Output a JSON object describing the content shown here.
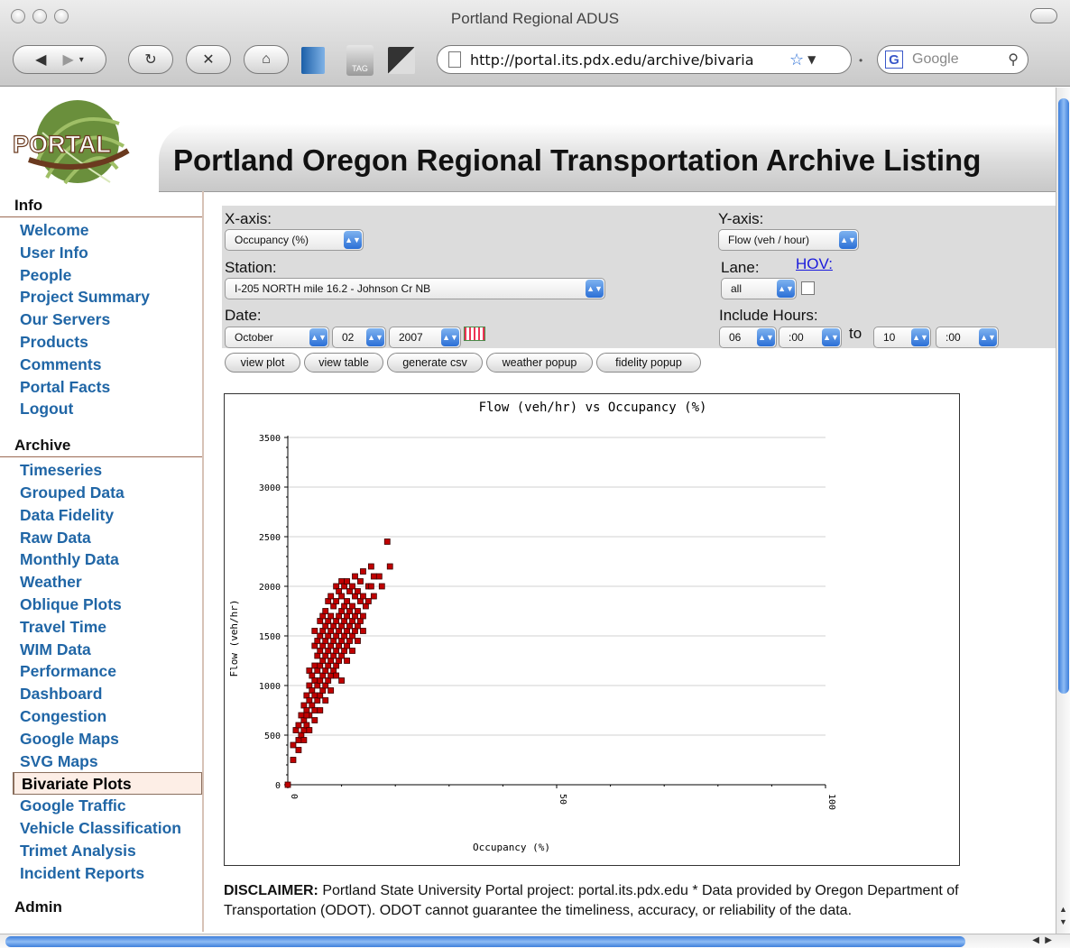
{
  "window": {
    "title": "Portland Regional ADUS"
  },
  "browser": {
    "url": "http://portal.its.pdx.edu/archive/bivaria",
    "search_placeholder": "Google",
    "tag_label": "TAG"
  },
  "header": {
    "logo_text": "PORTAL",
    "title": "Portland Oregon Regional Transportation Archive Listing"
  },
  "sidebar": {
    "info_heading": "Info",
    "info_items": [
      "Welcome",
      "User Info",
      "People",
      "Project Summary",
      "Our Servers",
      "Products",
      "Comments",
      "Portal Facts",
      "Logout"
    ],
    "archive_heading": "Archive",
    "archive_items": [
      "Timeseries",
      "Grouped Data",
      "Data Fidelity",
      "Raw Data",
      "Monthly Data",
      "Weather",
      "Oblique Plots",
      "Travel Time",
      "WIM Data",
      "Performance",
      "Dashboard",
      "Congestion",
      "Google Maps",
      "SVG Maps",
      "Bivariate Plots",
      "Google Traffic",
      "Vehicle Classification",
      "Trimet Analysis",
      "Incident Reports"
    ],
    "active_item": "Bivariate Plots",
    "admin_heading": "Admin"
  },
  "controls": {
    "xaxis_label": "X-axis:",
    "xaxis_value": "Occupancy (%)",
    "yaxis_label": "Y-axis:",
    "yaxis_value": "Flow (veh / hour)",
    "station_label": "Station:",
    "station_value": "I-205 NORTH mile 16.2 - Johnson Cr NB",
    "lane_label": "Lane:",
    "lane_value": "all",
    "hov_label": "HOV:",
    "date_label": "Date:",
    "month": "October",
    "day": "02",
    "year": "2007",
    "hours_label": "Include Hours:",
    "hour_from": "06",
    "min_from": ":00",
    "to_label": "to",
    "hour_to": "10",
    "min_to": ":00",
    "buttons": [
      "view plot",
      "view table",
      "generate csv",
      "weather popup",
      "fidelity popup"
    ]
  },
  "chart_data": {
    "type": "scatter",
    "title": "Flow (veh/hr) vs Occupancy (%)",
    "xlabel": "Occupancy (%)",
    "ylabel": "Flow (veh/hr)",
    "xlim": [
      0,
      100
    ],
    "ylim": [
      0,
      3500
    ],
    "x_ticks": [
      0,
      50,
      100
    ],
    "y_ticks": [
      0,
      500,
      1000,
      1500,
      2000,
      2500,
      3000,
      3500
    ],
    "grid": "horizontal",
    "marker_color": "#c00000",
    "points": [
      [
        0,
        0
      ],
      [
        1,
        250
      ],
      [
        1,
        400
      ],
      [
        1.5,
        550
      ],
      [
        2,
        350
      ],
      [
        2,
        450
      ],
      [
        2,
        600
      ],
      [
        2.5,
        500
      ],
      [
        2.5,
        700
      ],
      [
        3,
        550
      ],
      [
        3,
        650
      ],
      [
        3,
        800
      ],
      [
        3.5,
        600
      ],
      [
        3.5,
        750
      ],
      [
        3.5,
        900
      ],
      [
        4,
        700
      ],
      [
        4,
        850
      ],
      [
        4,
        1000
      ],
      [
        4,
        1150
      ],
      [
        4.5,
        800
      ],
      [
        4.5,
        950
      ],
      [
        4.5,
        1100
      ],
      [
        5,
        750
      ],
      [
        5,
        900
      ],
      [
        5,
        1050
      ],
      [
        5,
        1200
      ],
      [
        5,
        1400
      ],
      [
        5,
        1550
      ],
      [
        5.5,
        850
      ],
      [
        5.5,
        1000
      ],
      [
        5.5,
        1150
      ],
      [
        5.5,
        1300
      ],
      [
        5.5,
        1450
      ],
      [
        6,
        900
      ],
      [
        6,
        1050
      ],
      [
        6,
        1200
      ],
      [
        6,
        1350
      ],
      [
        6,
        1500
      ],
      [
        6,
        1650
      ],
      [
        6.5,
        950
      ],
      [
        6.5,
        1100
      ],
      [
        6.5,
        1250
      ],
      [
        6.5,
        1400
      ],
      [
        6.5,
        1550
      ],
      [
        6.5,
        1700
      ],
      [
        7,
        1000
      ],
      [
        7,
        1150
      ],
      [
        7,
        1300
      ],
      [
        7,
        1450
      ],
      [
        7,
        1600
      ],
      [
        7,
        1750
      ],
      [
        7.5,
        1050
      ],
      [
        7.5,
        1200
      ],
      [
        7.5,
        1350
      ],
      [
        7.5,
        1500
      ],
      [
        7.5,
        1650
      ],
      [
        7.5,
        1850
      ],
      [
        8,
        1100
      ],
      [
        8,
        1250
      ],
      [
        8,
        1400
      ],
      [
        8,
        1550
      ],
      [
        8,
        1700
      ],
      [
        8,
        1900
      ],
      [
        8.5,
        1150
      ],
      [
        8.5,
        1300
      ],
      [
        8.5,
        1450
      ],
      [
        8.5,
        1600
      ],
      [
        8.5,
        1800
      ],
      [
        9,
        1200
      ],
      [
        9,
        1350
      ],
      [
        9,
        1500
      ],
      [
        9,
        1650
      ],
      [
        9,
        1850
      ],
      [
        9,
        2000
      ],
      [
        9.5,
        1250
      ],
      [
        9.5,
        1400
      ],
      [
        9.5,
        1550
      ],
      [
        9.5,
        1700
      ],
      [
        9.5,
        1950
      ],
      [
        10,
        1300
      ],
      [
        10,
        1450
      ],
      [
        10,
        1600
      ],
      [
        10,
        1750
      ],
      [
        10,
        1900
      ],
      [
        10,
        2050
      ],
      [
        10.5,
        1350
      ],
      [
        10.5,
        1500
      ],
      [
        10.5,
        1650
      ],
      [
        10.5,
        1800
      ],
      [
        10.5,
        2000
      ],
      [
        11,
        1400
      ],
      [
        11,
        1550
      ],
      [
        11,
        1700
      ],
      [
        11,
        1850
      ],
      [
        11,
        2050
      ],
      [
        11.5,
        1450
      ],
      [
        11.5,
        1600
      ],
      [
        11.5,
        1750
      ],
      [
        11.5,
        1950
      ],
      [
        12,
        1500
      ],
      [
        12,
        1650
      ],
      [
        12,
        1800
      ],
      [
        12,
        2000
      ],
      [
        12.5,
        1550
      ],
      [
        12.5,
        1700
      ],
      [
        12.5,
        1900
      ],
      [
        12.5,
        2100
      ],
      [
        13,
        1600
      ],
      [
        13,
        1750
      ],
      [
        13,
        1950
      ],
      [
        13.5,
        1650
      ],
      [
        13.5,
        1850
      ],
      [
        13.5,
        2050
      ],
      [
        14,
        1700
      ],
      [
        14,
        1900
      ],
      [
        14,
        2150
      ],
      [
        14.5,
        1800
      ],
      [
        15,
        1850
      ],
      [
        15,
        2000
      ],
      [
        15.5,
        2000
      ],
      [
        15.5,
        2200
      ],
      [
        16,
        1900
      ],
      [
        16,
        2100
      ],
      [
        17,
        2100
      ],
      [
        17.5,
        2000
      ],
      [
        18.5,
        2450
      ],
      [
        19,
        2200
      ],
      [
        10,
        1050
      ],
      [
        8,
        950
      ],
      [
        6,
        750
      ],
      [
        4,
        550
      ],
      [
        3,
        450
      ],
      [
        11,
        1250
      ],
      [
        12,
        1350
      ],
      [
        13,
        1450
      ],
      [
        14,
        1550
      ],
      [
        9,
        1100
      ],
      [
        7,
        850
      ],
      [
        5,
        650
      ],
      [
        3.5,
        700
      ]
    ]
  },
  "disclaimer": {
    "label": "DISCLAIMER:",
    "text": " Portland State University Portal project: portal.its.pdx.edu * Data provided by Oregon Department of Transportation (ODOT). ODOT cannot guarantee the timeliness, accuracy, or reliability of the data."
  }
}
